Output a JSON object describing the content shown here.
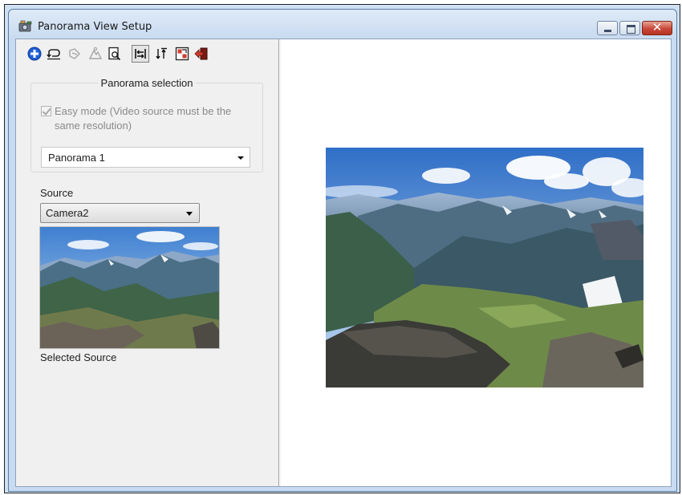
{
  "window": {
    "title": "Panorama View Setup",
    "controls": {
      "minimize": "minimize",
      "maximize": "maximize",
      "close": "✕"
    }
  },
  "toolbar": {
    "buttons": [
      {
        "name": "add-icon",
        "glyph": "➕"
      },
      {
        "name": "undo-icon",
        "glyph": "⤺"
      },
      {
        "name": "link-icon",
        "glyph": "🔗"
      },
      {
        "name": "mountain-icon",
        "glyph": "▲"
      },
      {
        "name": "preview-icon",
        "glyph": "🔍"
      },
      {
        "name": "align-left-icon",
        "glyph": "⇤"
      },
      {
        "name": "align-up-icon",
        "glyph": "⇅"
      },
      {
        "name": "grid-icon",
        "glyph": "▦"
      },
      {
        "name": "exit-icon",
        "glyph": "⇦"
      }
    ]
  },
  "panorama_selection": {
    "title": "Panorama selection",
    "easy_mode_label": "Easy mode (Video source must be the same resolution)",
    "easy_mode_checked": true,
    "selected": "Panorama 1"
  },
  "source": {
    "label": "Source",
    "selected": "Camera2",
    "selected_caption": "Selected Source"
  },
  "colors": {
    "accent_blue": "#1f5fd6",
    "close_red": "#c9483a",
    "disabled_text": "#8a8a8a"
  }
}
